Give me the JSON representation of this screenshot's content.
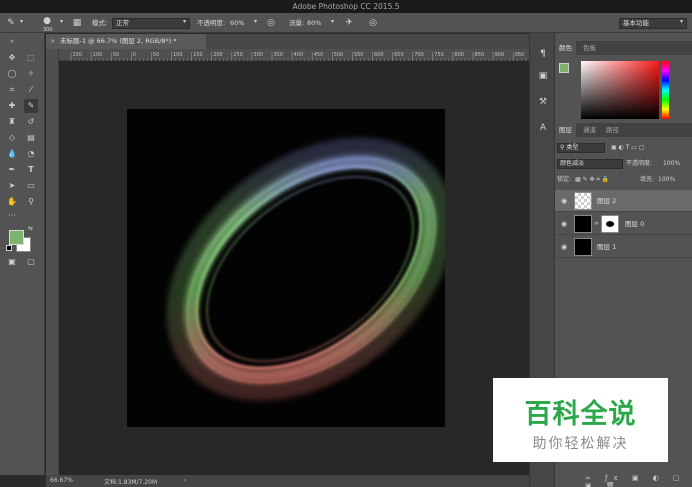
{
  "app": {
    "title": "Adobe Photoshop CC 2015.5"
  },
  "options_bar": {
    "brush_size": "300",
    "mode_label": "模式:",
    "mode_value": "正常",
    "opacity_label": "不透明度:",
    "opacity_value": "60%",
    "flow_label": "流量:",
    "flow_value": "80%",
    "workspace": "基本功能"
  },
  "document": {
    "tab_title": "未标题-1 @ 66.7% (图层 2, RGB/8*) *",
    "close_glyph": "×"
  },
  "ruler": {
    "h_ticks": [
      "150",
      "100",
      "50",
      "0",
      "50",
      "100",
      "150",
      "200",
      "250",
      "300",
      "350",
      "400",
      "450",
      "500",
      "550",
      "600",
      "650",
      "700",
      "750",
      "800",
      "850",
      "900",
      "950"
    ]
  },
  "status": {
    "zoom": "66.67%",
    "doc_info": "文档:1.83M/7.20M",
    "arrow": "›"
  },
  "color_panel": {
    "tabs": [
      "颜色",
      "色板"
    ]
  },
  "layers_panel": {
    "tabs": [
      "图层",
      "通道",
      "路径"
    ],
    "filter_kind": "类型",
    "blend_mode": "颜色减淡",
    "opacity_label": "不透明度:",
    "opacity_value": "100%",
    "lock_label": "锁定:",
    "fill_label": "填充:",
    "fill_value": "100%",
    "layers": [
      {
        "name": "图层 2",
        "selected": true
      },
      {
        "name": "图层 0",
        "selected": false
      },
      {
        "name": "图层 1",
        "selected": false
      }
    ]
  },
  "colors": {
    "foreground": "#7bb36f",
    "background": "#ffffff",
    "canvas": "#030303"
  },
  "watermark": {
    "title": "百科全说",
    "subtitle": "助你轻松解决"
  }
}
